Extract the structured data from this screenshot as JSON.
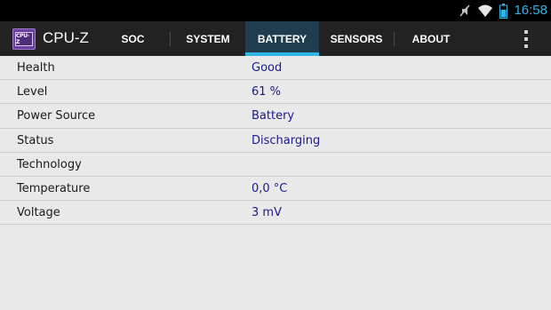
{
  "statusbar": {
    "time": "16:58",
    "icons": [
      "no-sound-icon",
      "wifi-icon",
      "battery-icon"
    ],
    "accent": "#33b5e5"
  },
  "app": {
    "logo_text": "CPU-Z",
    "title": "CPU-Z"
  },
  "tabs": [
    {
      "label": "SOC",
      "selected": false
    },
    {
      "label": "SYSTEM",
      "selected": false
    },
    {
      "label": "BATTERY",
      "selected": true
    },
    {
      "label": "SENSORS",
      "selected": false
    },
    {
      "label": "ABOUT",
      "selected": false
    }
  ],
  "colors": {
    "actionbar": "#222222",
    "selected_tab": "#1f3d4f",
    "indicator": "#33b5e5",
    "value_text": "#1a1a8c",
    "background": "#e9e9e9"
  },
  "battery": {
    "rows": [
      {
        "label": "Health",
        "value": "Good"
      },
      {
        "label": "Level",
        "value": "61 %"
      },
      {
        "label": "Power Source",
        "value": "Battery"
      },
      {
        "label": "Status",
        "value": "Discharging"
      },
      {
        "label": "Technology",
        "value": ""
      },
      {
        "label": "Temperature",
        "value": "0,0 °C"
      },
      {
        "label": "Voltage",
        "value": "3 mV"
      }
    ]
  }
}
